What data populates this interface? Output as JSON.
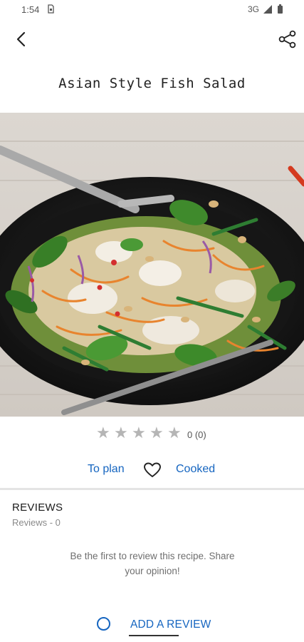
{
  "status_bar": {
    "time": "1:54",
    "network": "3G",
    "icons": [
      "sim-card-icon",
      "signal-icon",
      "battery-icon"
    ]
  },
  "top_bar": {
    "icons": [
      "arrow-back-icon",
      "share-icon"
    ]
  },
  "recipe": {
    "title": "Asian Style Fish Salad"
  },
  "rating": {
    "stars_filled": 0,
    "stars_total": 5,
    "value_text": "0 (0)"
  },
  "actions": {
    "to_plan_label": "To plan",
    "cooked_label": "Cooked",
    "favorite_icon": "heart-outline-icon"
  },
  "reviews": {
    "heading": "REVIEWS",
    "count_text": "Reviews - 0",
    "empty_message": "Be the first to review this recipe. Share your opinion!",
    "add_review_label": "ADD A REVIEW"
  },
  "colors": {
    "accent": "#1565c0",
    "star": "#b5b5b5",
    "text_primary": "#1f1f1f",
    "text_secondary": "#6f6f6f"
  }
}
